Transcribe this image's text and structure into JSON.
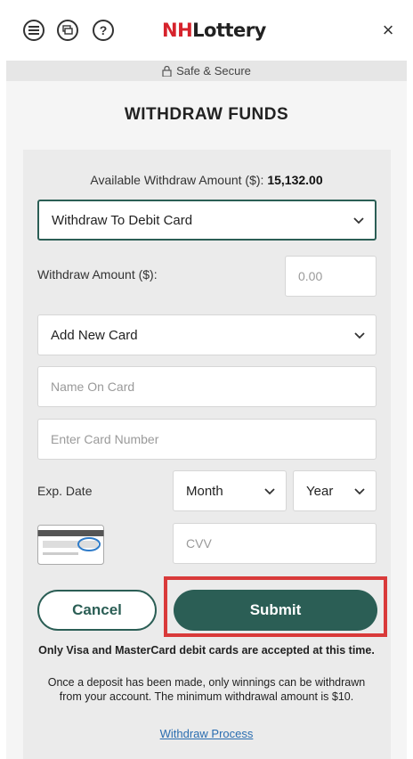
{
  "header": {
    "logo_nh": "NH",
    "logo_rest": "Lottery",
    "close_symbol": "×",
    "icons": [
      "menu-icon",
      "chat-icon",
      "help-icon",
      "close-icon"
    ]
  },
  "secure_bar": {
    "text": "Safe & Secure"
  },
  "page": {
    "title": "WITHDRAW FUNDS"
  },
  "available": {
    "label": "Available Withdraw Amount ($):",
    "amount": "15,132.00"
  },
  "method_select": {
    "value": "Withdraw To Debit Card"
  },
  "withdraw_amount": {
    "label": "Withdraw Amount ($):",
    "placeholder": "0.00"
  },
  "card_select": {
    "value": "Add New Card"
  },
  "name_on_card": {
    "placeholder": "Name On Card"
  },
  "card_number": {
    "placeholder": "Enter Card Number"
  },
  "exp": {
    "label": "Exp. Date",
    "month": "Month",
    "year": "Year"
  },
  "cvv": {
    "placeholder": "CVV"
  },
  "buttons": {
    "cancel": "Cancel",
    "submit": "Submit"
  },
  "notes": {
    "bold": "Only Visa and MasterCard debit cards are accepted at this time.",
    "body": "Once a deposit has been made, only winnings can be withdrawn from your account. The minimum withdrawal amount is $10."
  },
  "link": {
    "text": "Withdraw Process"
  },
  "colors": {
    "brand_green": "#2b5e55",
    "highlight_red": "#d93a3a",
    "logo_red": "#d6232c"
  }
}
